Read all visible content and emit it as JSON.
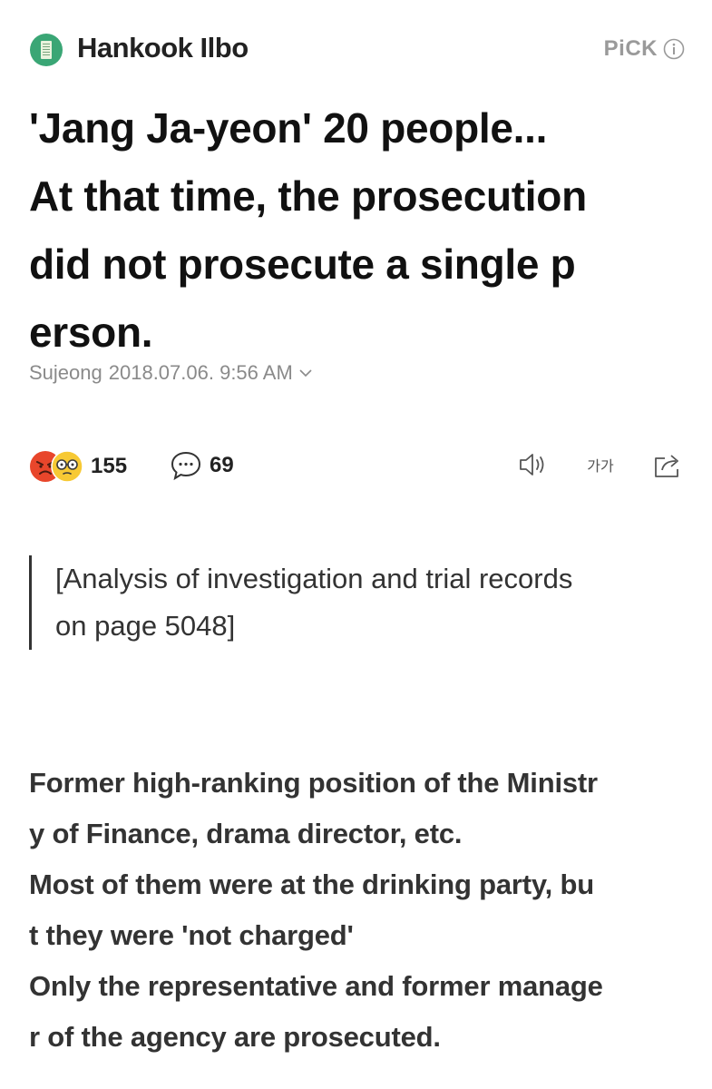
{
  "header": {
    "press_name": "Hankook Ilbo",
    "pick_label": "PiCK",
    "logo_icon": "newspaper-logo-icon",
    "info_icon": "info-circle-icon"
  },
  "article": {
    "headline_lines": [
      "'Jang Ja-yeon' 20 people...",
      "At that time, the prosecution",
      "did not prosecute a single p",
      "erson."
    ],
    "author": "Sujeong",
    "date": "2018.07.06. 9:56 AM"
  },
  "actions": {
    "reaction_count": "155",
    "comment_count": "69",
    "reaction_icons": [
      "angry-face-icon",
      "glasses-face-icon"
    ],
    "comment_icon": "speech-bubble-icon",
    "tts_icon": "speaker-icon",
    "font_size_label": "가가",
    "share_icon": "share-icon"
  },
  "quote": {
    "lines": [
      "[Analysis of investigation and trial records",
      "on page 5048]"
    ]
  },
  "body": {
    "lines": [
      "Former high-ranking position of the Ministr",
      "y of Finance, drama director, etc.",
      "Most of them were at the drinking party, bu",
      "t they were 'not charged'",
      "Only the representative and former manage",
      "r of the agency are prosecuted."
    ]
  },
  "colors": {
    "logo_green": "#3aa675",
    "meta_gray": "#8a8a8a",
    "angry_red": "#e8462b",
    "emoji_yellow": "#f7c934"
  }
}
